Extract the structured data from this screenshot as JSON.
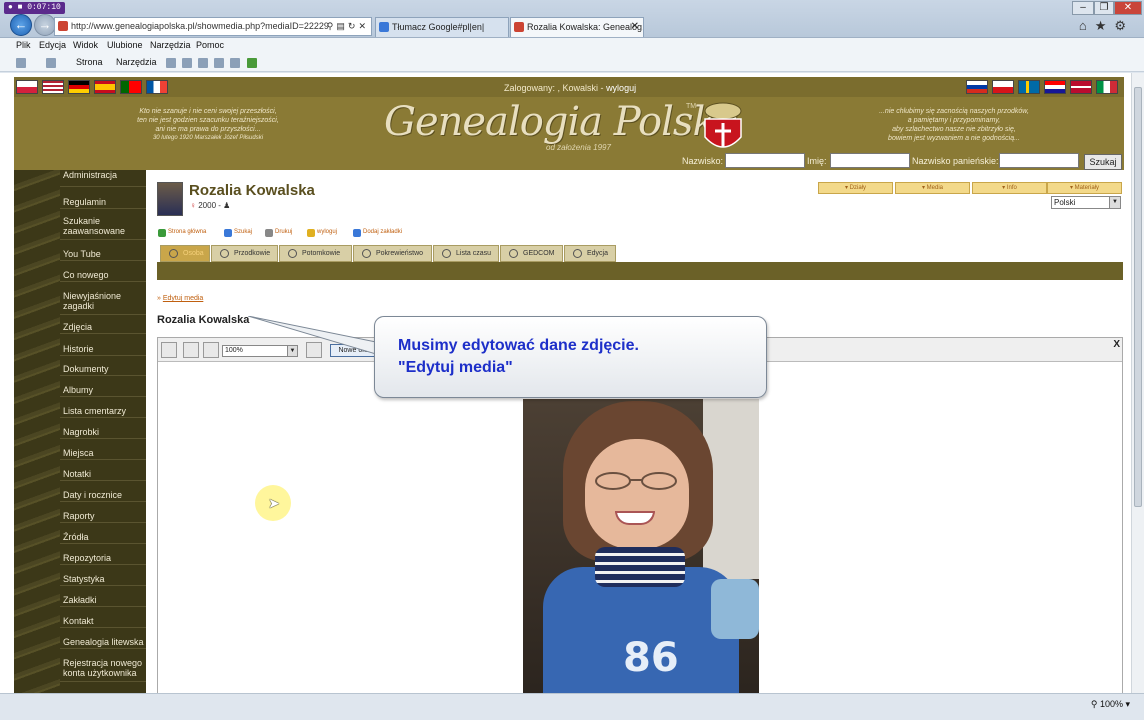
{
  "recorder": {
    "time": "0:07:10"
  },
  "browser": {
    "url": "http://www.genealogiapolska.pl/showmedia.php?mediaID=22229",
    "tabs": [
      {
        "label": "Tłumacz Google#pl|en|"
      },
      {
        "label": "Rozalia Kowalska: Genealog..."
      }
    ],
    "menu": [
      "Plik",
      "Edycja",
      "Widok",
      "Ulubione",
      "Narzędzia",
      "Pomoc"
    ],
    "commands": {
      "strona": "Strona",
      "narzedzia": "Narzędzia"
    },
    "zoom": "100%"
  },
  "site": {
    "login_prefix": "Zalogowany: , Kowalski -",
    "logout": "wyloguj",
    "logo": "Genealogia Polska",
    "logo_mark": "TM",
    "logo_sub": "od założenia 1997",
    "quote_left": [
      "Kto nie szanuje i nie ceni swojej przeszłości,",
      "ten nie jest godzien szacunku teraźniejszości,",
      "ani nie ma prawa do przyszłości...",
      "30 lutego 1920 Marszałek Józef Piłsudski"
    ],
    "quote_right": [
      "...nie chlubimy się zacnością naszych przodków,",
      "a pamiętamy i przypominamy,",
      "aby szlachectwo nasze nie zbitrzyło się,",
      "bowiem jest wyzwaniem a nie godnością..."
    ],
    "search": {
      "nazwisko": "Nazwisko:",
      "imie": "Imię:",
      "panienskie": "Nazwisko panieńskie:",
      "button": "Szukaj"
    }
  },
  "sidebar": [
    "Administracja",
    "Regulamin",
    "Szukanie zaawansowane",
    "You Tube",
    "Co nowego",
    "Niewyjaśnione zagadki",
    "Zdjęcia",
    "Historie",
    "Dokumenty",
    "Albumy",
    "Lista cmentarzy",
    "Nagrobki",
    "Miejsca",
    "Notatki",
    "Daty i rocznice",
    "Raporty",
    "Źródła",
    "Repozytoria",
    "Statystyka",
    "Zakładki",
    "Kontakt",
    "Genealogia litewska",
    "Rejestracja nowego konta użytkownika"
  ],
  "person": {
    "name": "Rozalia Kowalska",
    "year": "2000 -"
  },
  "top_buttons": [
    "Działy",
    "Media",
    "Info",
    "Materiały"
  ],
  "language": "Polski",
  "actions": [
    "Strona główna",
    "Szukaj",
    "Drukuj",
    "wyloguj",
    "Dodaj zakładki"
  ],
  "page_tabs": [
    "Osoba",
    "Przodkowie",
    "Potomkowie",
    "Pokrewieństwo",
    "Lista czasu",
    "GEDCOM",
    "Edycja"
  ],
  "breadcrumb": {
    "prefix": "»",
    "link": "Edytuj media"
  },
  "media_title": "Rozalia Kowalska",
  "viewer": {
    "zoom": "100%",
    "new_window": "Nowe okno",
    "close": "X"
  },
  "photo": {
    "shirt_number": "86"
  },
  "tooltip": {
    "line1": "Musimy edytować dane zdjęcie.",
    "line2": "\"Edytuj media\""
  }
}
